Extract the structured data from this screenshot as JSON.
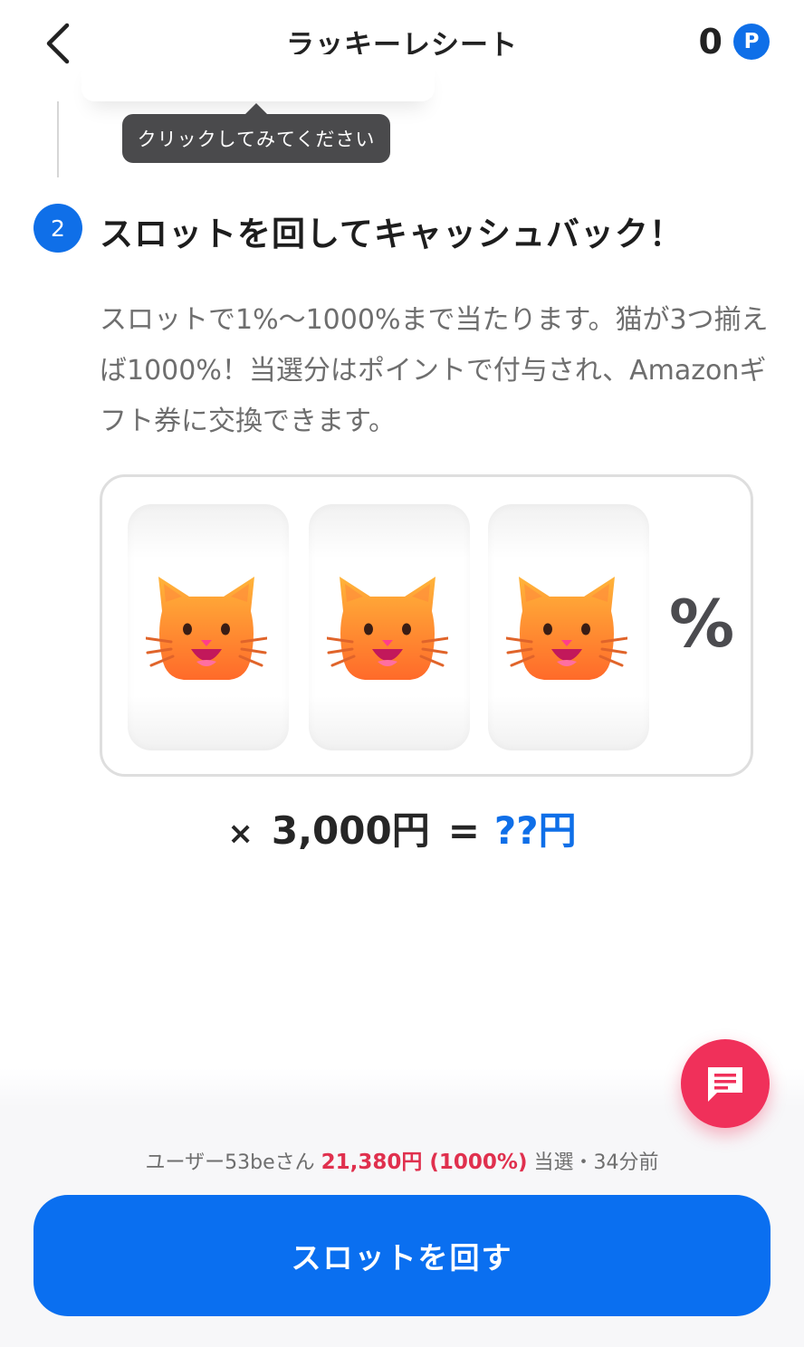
{
  "header": {
    "title": "ラッキーレシート",
    "points_value": "0",
    "points_badge": "P"
  },
  "tooltip": {
    "text": "クリックしてみてください"
  },
  "step2": {
    "number": "2",
    "title": "スロットを回してキャッシュバック！",
    "description": "スロットで1%～1000%まで当たります。猫が3つ揃えば1000%！当選分はポイントで付与され、Amazonギフト券に交換できます。"
  },
  "slot": {
    "reels": [
      "cat-face-icon",
      "cat-face-icon",
      "cat-face-icon"
    ],
    "percent_sign": "%"
  },
  "formula": {
    "multiply": "×",
    "amount": "3,000円",
    "equals": "=",
    "result": "??円"
  },
  "recent_win": {
    "user": "ユーザー53beさん",
    "amount": "21,380円 (1000%)",
    "status": "当選・34分前"
  },
  "spin_button": {
    "label": "スロットを回す"
  },
  "colors": {
    "primary": "#0a6ff0",
    "accent_red": "#f0305a",
    "win_amount": "#e0304e"
  }
}
